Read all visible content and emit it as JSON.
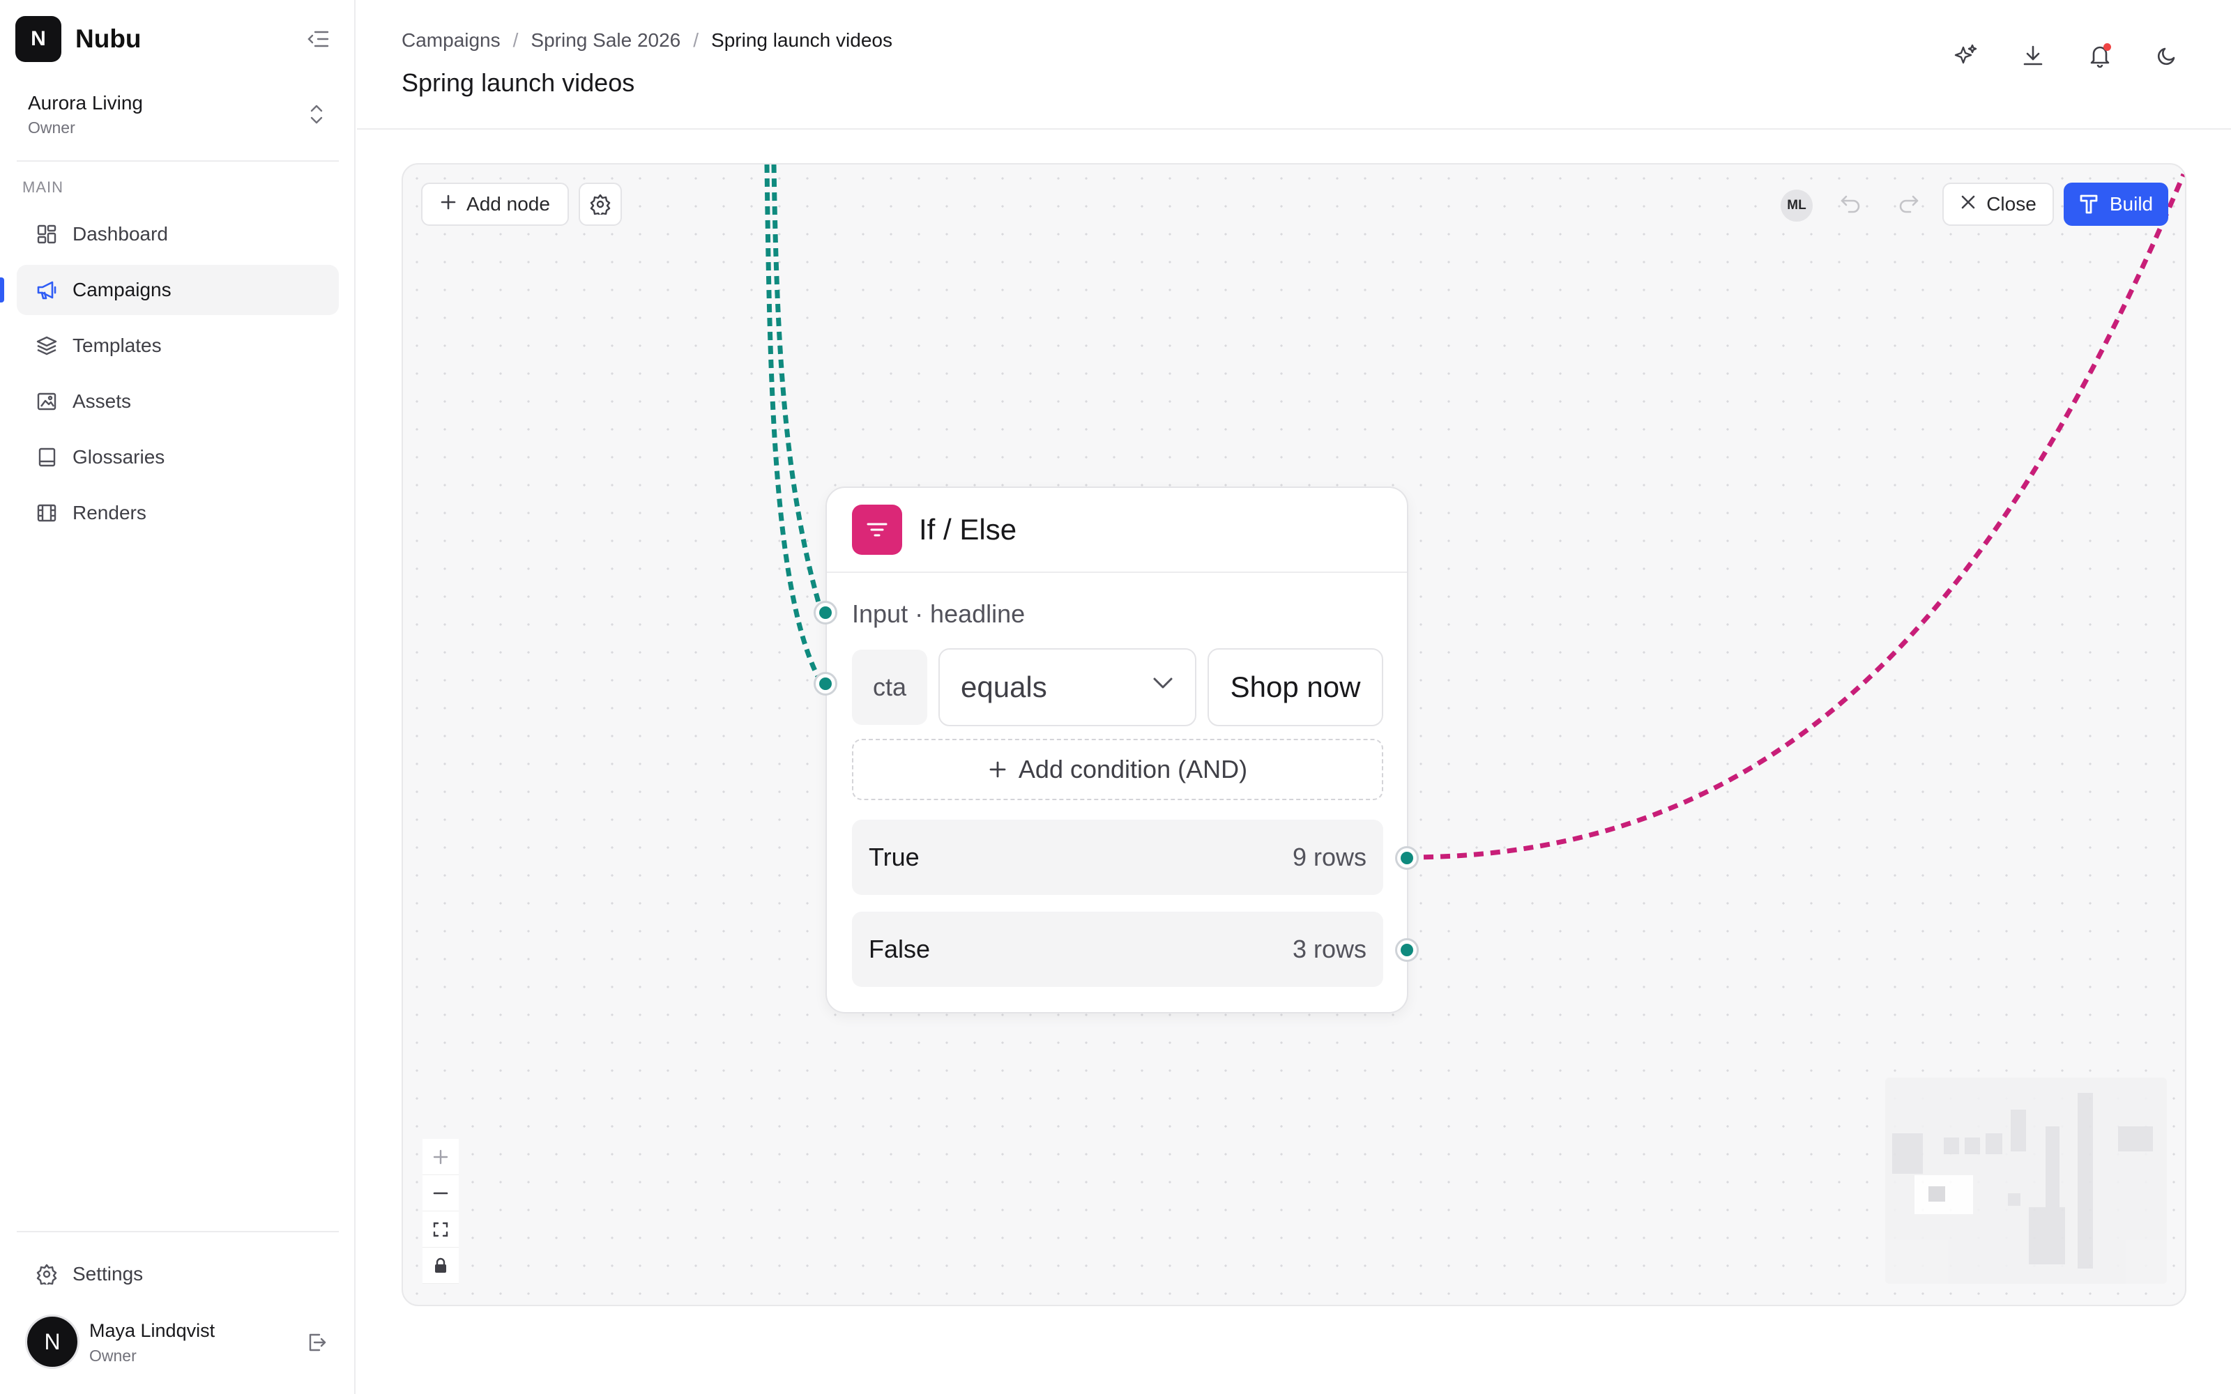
{
  "app": {
    "logo_letter": "N",
    "name": "Nubu"
  },
  "workspace": {
    "name": "Aurora Living",
    "role": "Owner"
  },
  "sidebar": {
    "section": "MAIN",
    "items": [
      {
        "label": "Dashboard",
        "icon": "dashboard-icon"
      },
      {
        "label": "Campaigns",
        "icon": "megaphone-icon",
        "active": true
      },
      {
        "label": "Templates",
        "icon": "layers-icon"
      },
      {
        "label": "Assets",
        "icon": "image-folder-icon"
      },
      {
        "label": "Glossaries",
        "icon": "book-icon"
      },
      {
        "label": "Renders",
        "icon": "film-icon"
      }
    ],
    "settings_label": "Settings"
  },
  "user": {
    "initial": "N",
    "name": "Maya Lindqvist",
    "role": "Owner"
  },
  "header": {
    "breadcrumb": [
      "Campaigns",
      "Spring Sale 2026",
      "Spring launch videos"
    ],
    "title": "Spring launch videos"
  },
  "canvas": {
    "add_node_label": "Add node",
    "collaborator_initials": "ML",
    "close_label": "Close",
    "build_label": "Build"
  },
  "node": {
    "title": "If / Else",
    "input_label": "Input · headline",
    "condition": {
      "field": "cta",
      "operator": "equals",
      "value": "Shop now"
    },
    "add_condition_label": "Add condition (AND)",
    "branches": [
      {
        "label": "True",
        "count": "9 rows"
      },
      {
        "label": "False",
        "count": "3 rows"
      }
    ]
  },
  "colors": {
    "accent": "#2f5cf5",
    "node_icon": "#db2777",
    "edge_input": "#0f8a7e",
    "edge_output": "#c81e78",
    "notification": "#ef4444"
  }
}
